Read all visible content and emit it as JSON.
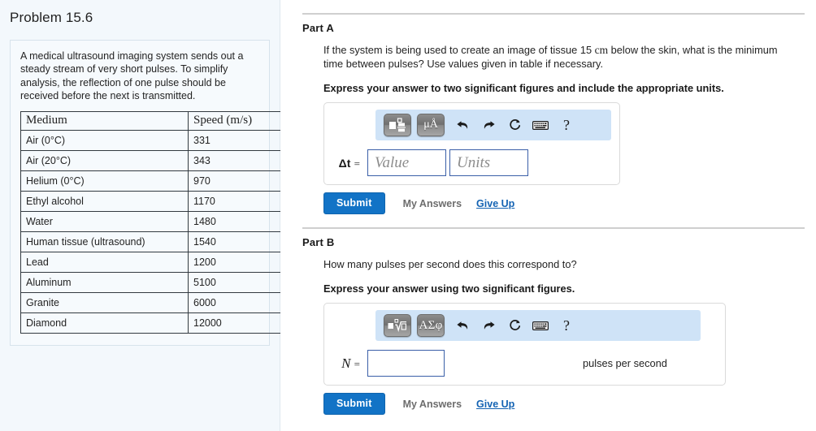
{
  "problem": {
    "title": "Problem 15.6",
    "statement": "A medical ultrasound imaging system sends out a steady stream of very short pulses. To simplify analysis, the reflection of one pulse should be received before the next is transmitted.",
    "table": {
      "headers": [
        "Medium",
        "Speed (m/s)"
      ],
      "rows": [
        [
          "Air (0°C)",
          "331"
        ],
        [
          "Air (20°C)",
          "343"
        ],
        [
          "Helium (0°C)",
          "970"
        ],
        [
          "Ethyl alcohol",
          "1170"
        ],
        [
          "Water",
          "1480"
        ],
        [
          "Human tissue (ultrasound)",
          "1540"
        ],
        [
          "Lead",
          "1200"
        ],
        [
          "Aluminum",
          "5100"
        ],
        [
          "Granite",
          "6000"
        ],
        [
          "Diamond",
          "12000"
        ]
      ]
    }
  },
  "parts": [
    {
      "heading": "Part A",
      "question_pre": "If the system is being used to create an image of tissue 15 ",
      "question_unit": "cm",
      "question_post": " below the skin, what is the minimum time between pulses? Use values given in table if necessary.",
      "instruction": "Express your answer to two significant figures and include the appropriate units.",
      "toolbar": {
        "template_icon": "math-template-fraction-icon",
        "symbols_label": "μÅ",
        "undo_icon": "undo-arrow-icon",
        "redo_icon": "redo-arrow-icon",
        "reset_icon": "reset-circular-arrow-icon",
        "keyboard_icon": "keyboard-icon",
        "help_label": "?"
      },
      "variable": "Δt",
      "equals": "=",
      "value_placeholder": "Value",
      "units_placeholder": "Units",
      "value": "",
      "units": "",
      "trailing_units": "",
      "submit_label": "Submit",
      "my_answers_label": "My Answers",
      "give_up_label": "Give Up"
    },
    {
      "heading": "Part B",
      "question_pre": "How many pulses per second does this correspond to?",
      "question_unit": "",
      "question_post": "",
      "instruction": "Express your answer using two significant figures.",
      "toolbar": {
        "template_icon": "math-template-nth-root-icon",
        "symbols_label": "ΑΣφ",
        "undo_icon": "undo-arrow-icon",
        "redo_icon": "redo-arrow-icon",
        "reset_icon": "reset-circular-arrow-icon",
        "keyboard_icon": "keyboard-icon",
        "help_label": "?"
      },
      "variable": "N",
      "equals": "=",
      "value_placeholder": "",
      "units_placeholder": "",
      "value": "",
      "units": "",
      "trailing_units": "pulses per second",
      "submit_label": "Submit",
      "my_answers_label": "My Answers",
      "give_up_label": "Give Up"
    }
  ],
  "colors": {
    "accent_blue": "#1273c6",
    "link_blue": "#1463b3",
    "toolbar_blue": "#cfe3f7",
    "panel_bg": "#f3f8fc",
    "input_border": "#3a5fa8",
    "rule_gray": "#cfcfcf"
  }
}
